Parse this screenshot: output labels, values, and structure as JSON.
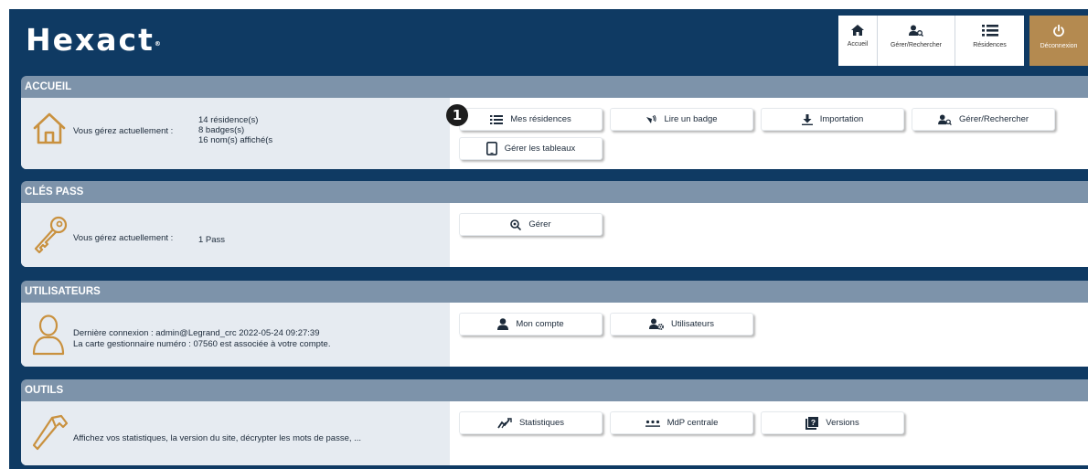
{
  "header": {
    "logo": "Hexact",
    "logo_mark": "®",
    "nav": [
      {
        "label": "Accueil",
        "icon": "home-icon"
      },
      {
        "label": "Gérer/Rechercher",
        "icon": "user-search-icon"
      },
      {
        "label": "Résidences",
        "icon": "list-icon"
      }
    ],
    "logout_label": "Déconnexion",
    "logout_color": "#b48a50"
  },
  "sections": {
    "accueil": {
      "title": "ACCUEIL",
      "label": "Vous gérez actuellement :",
      "lines": [
        "14 résidence(s)",
        "8 badges(s)",
        "16 nom(s) affiché(s"
      ],
      "buttons": [
        "Mes résidences",
        "Lire un badge",
        "Importation",
        "Gérer/Rechercher",
        "Gérer les tableaux"
      ]
    },
    "cles_pass": {
      "title": "CLÉS PASS",
      "label": "Vous gérez actuellement :",
      "value": "1 Pass",
      "buttons": [
        "Gérer"
      ]
    },
    "utilisateurs": {
      "title": "UTILISATEURS",
      "line1": "Dernière connexion   : admin@Legrand_crc  2022-05-24 09:27:39",
      "line2": "La carte gestionnaire numéro :   07560 est associée à votre compte.",
      "buttons": [
        "Mon compte",
        "Utilisateurs"
      ]
    },
    "outils": {
      "title": "OUTILS",
      "text": "Affichez vos statistiques, la version du site, décrypter les mots de passe, ...",
      "buttons": [
        "Statistiques",
        "MdP centrale",
        "Versions"
      ]
    }
  },
  "callout": "1",
  "colors": {
    "header_bg": "#0f3a63",
    "section_head": "#7d93aa",
    "info_bg": "#e6ebf1",
    "icon_gold": "#c9913f"
  }
}
